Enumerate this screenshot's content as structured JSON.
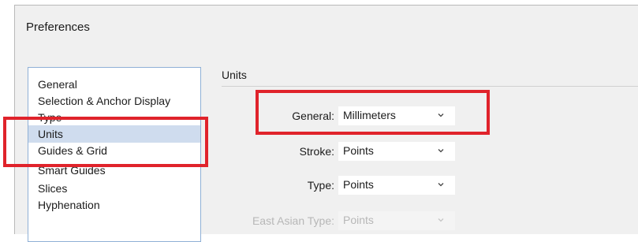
{
  "window": {
    "title": "Preferences"
  },
  "sidebar": {
    "items": [
      {
        "label": "General"
      },
      {
        "label": "Selection & Anchor Display"
      },
      {
        "label": "Type"
      },
      {
        "label": "Units"
      },
      {
        "label": "Guides & Grid"
      },
      {
        "label": "Smart Guides"
      },
      {
        "label": "Slices"
      },
      {
        "label": "Hyphenation"
      }
    ],
    "selected": "Units"
  },
  "units": {
    "section_title": "Units",
    "general": {
      "label": "General:",
      "value": "Millimeters"
    },
    "stroke": {
      "label": "Stroke:",
      "value": "Points"
    },
    "type": {
      "label": "Type:",
      "value": "Points"
    },
    "east_asian_type": {
      "label": "East Asian Type:",
      "value": "Points"
    }
  },
  "icons": {
    "dropdown": "chevron-down-icon"
  },
  "colors": {
    "highlight": "#e0232b",
    "selection": "#cfdcee"
  }
}
